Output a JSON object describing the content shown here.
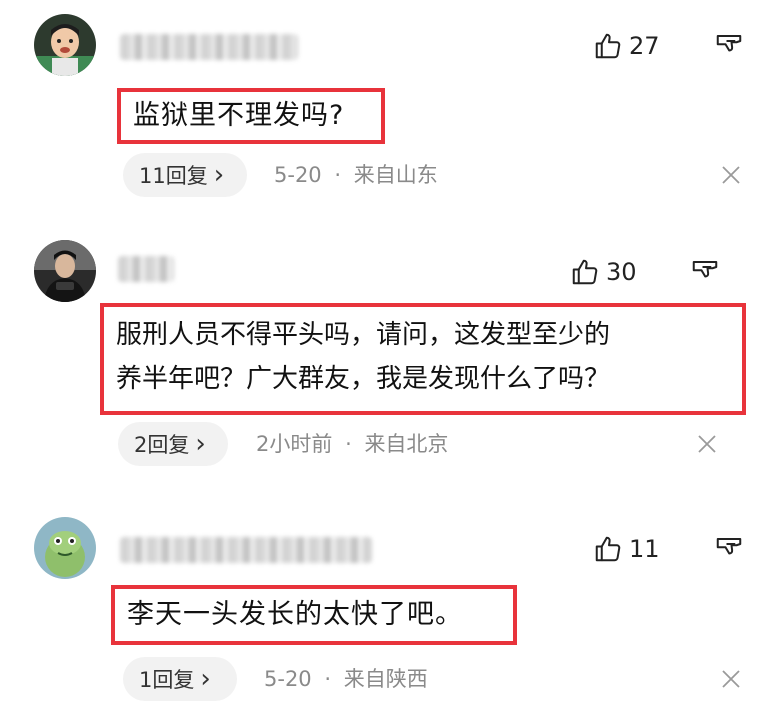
{
  "comments": [
    {
      "like_count": "27",
      "text": "监狱里不理发吗?",
      "reply_label": "11回复",
      "reply_chevron": "›",
      "date": "5-20",
      "separator": "·",
      "location": "来自山东",
      "avatar_icon": "child-avatar-icon",
      "username_blurred": true
    },
    {
      "like_count": "30",
      "text_line1": "服刑人员不得平头吗，请问，这发型至少的",
      "text_line2": "养半年吧？广大群友，我是发现什么了吗？",
      "reply_label": "2回复",
      "reply_chevron": "›",
      "date": "2小时前",
      "separator": "·",
      "location": "来自北京",
      "avatar_icon": "person-avatar-icon",
      "username_blurred": true
    },
    {
      "like_count": "11",
      "text": "李天一头发长的太快了吧。",
      "reply_label": "1回复",
      "reply_chevron": "›",
      "date": "5-20",
      "separator": "·",
      "location": "来自陕西",
      "avatar_icon": "cartoon-avatar-icon",
      "username_blurred": true
    }
  ],
  "icons": {
    "like": "thumbs-up-icon",
    "dislike": "thumbs-down-icon",
    "close": "close-icon"
  },
  "colors": {
    "highlight_border": "#e8333b",
    "meta_text": "#8a8a8a",
    "pill_bg": "#f2f2f2"
  }
}
